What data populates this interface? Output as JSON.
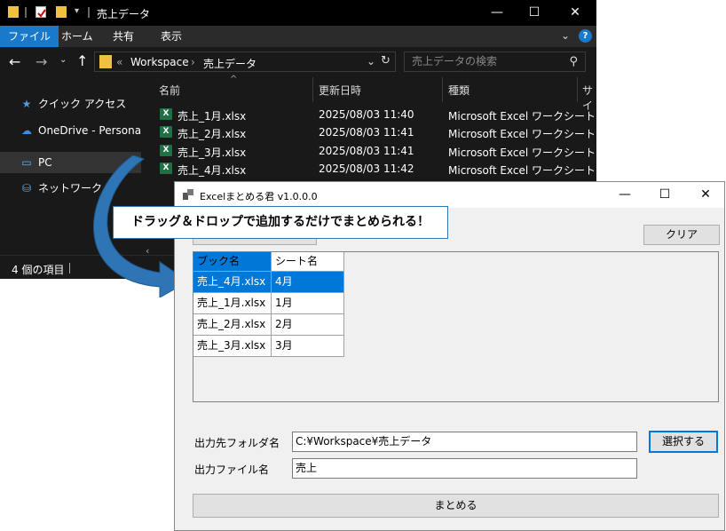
{
  "explorer": {
    "title": "売上データ",
    "tabs": [
      "ファイル",
      "ホーム",
      "共有",
      "表示"
    ],
    "breadcrumb": [
      "«",
      "Workspace",
      "›",
      "売上データ"
    ],
    "search_placeholder": "売上データの検索",
    "sidebar": [
      {
        "label": "クイック アクセス",
        "icon": "star-icon"
      },
      {
        "label": "OneDrive - Personal",
        "icon": "cloud-icon"
      },
      {
        "label": "PC",
        "icon": "pc-icon"
      },
      {
        "label": "ネットワーク",
        "icon": "network-icon"
      }
    ],
    "columns": [
      "名前",
      "更新日時",
      "種類",
      "サイ"
    ],
    "files": [
      {
        "name": "売上_1月.xlsx",
        "modified": "2025/08/03 11:40",
        "type": "Microsoft Excel ワークシート"
      },
      {
        "name": "売上_2月.xlsx",
        "modified": "2025/08/03 11:41",
        "type": "Microsoft Excel ワークシート"
      },
      {
        "name": "売上_3月.xlsx",
        "modified": "2025/08/03 11:41",
        "type": "Microsoft Excel ワークシート"
      },
      {
        "name": "売上_4月.xlsx",
        "modified": "2025/08/03 11:42",
        "type": "Microsoft Excel ワークシート"
      }
    ],
    "status": "4 個の項目"
  },
  "callout": "ドラッグ＆ドロップで追加するだけでまとめられる！",
  "app": {
    "title": "Excelまとめる君 v1.0.0.0",
    "clear_label": "クリア",
    "grid_headers": [
      "ブック名",
      "シート名"
    ],
    "grid_rows": [
      {
        "book": "売上_4月.xlsx",
        "sheet": "4月"
      },
      {
        "book": "売上_1月.xlsx",
        "sheet": "1月"
      },
      {
        "book": "売上_2月.xlsx",
        "sheet": "2月"
      },
      {
        "book": "売上_3月.xlsx",
        "sheet": "3月"
      }
    ],
    "output_folder_label": "出力先フォルダ名",
    "output_folder_value": "C:¥Workspace¥売上データ",
    "browse_label": "選択する",
    "output_file_label": "出力ファイル名",
    "output_file_value": "売上",
    "merge_label": "まとめる"
  },
  "colors": {
    "selection": "#0078d7",
    "ribbon_active": "#1979ca",
    "arrow": "#2e75b6"
  }
}
